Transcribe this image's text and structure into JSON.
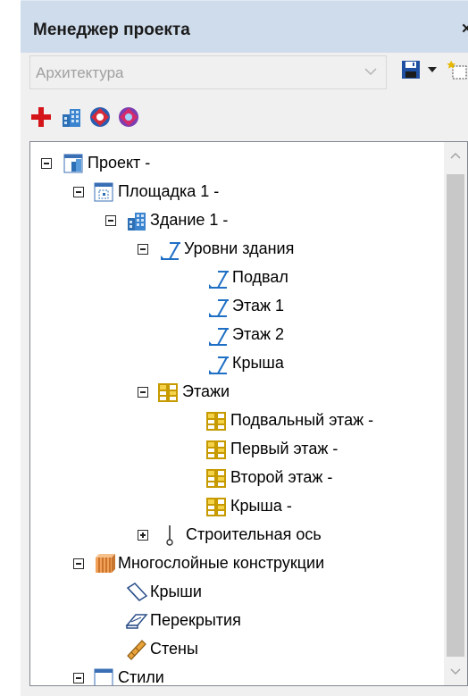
{
  "window": {
    "title": "Менеджер проекта",
    "close": "×"
  },
  "combo": {
    "value": "Архитектура"
  },
  "tree": {
    "project": "Проект -",
    "site": "Площадка 1 -",
    "building": "Здание 1 -",
    "levels": "Уровни здания",
    "level_basement": "Подвал",
    "level_floor1": "Этаж 1",
    "level_floor2": "Этаж 2",
    "level_roof": "Крыша",
    "storeys": "Этажи",
    "storey_basement": "Подвальный этаж -",
    "storey_first": "Первый этаж -",
    "storey_second": "Второй этаж -",
    "storey_roof": "Крыша -",
    "grid_axis": "Строительная ось",
    "multilayer": "Многослойные конструкции",
    "ml_roofs": "Крыши",
    "ml_slabs": "Перекрытия",
    "ml_walls": "Стены",
    "partial_next": "Стили"
  },
  "colors": {
    "titlebar": "#cfdcec",
    "panel_bg": "#f0f0f0",
    "level_icon": "#1f6fc4",
    "storey_icon": "#d8b010",
    "add_icon": "#d4161b"
  }
}
